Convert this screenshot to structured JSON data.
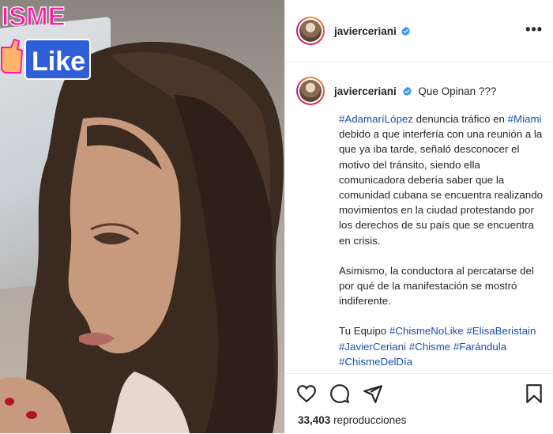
{
  "overlay": {
    "line1": "ISME",
    "line2": "Like"
  },
  "header": {
    "username": "javierceriani",
    "more_label": "•••"
  },
  "caption": {
    "username": "javierceriani",
    "headline": "Que Opinan ???",
    "para1_parts": [
      {
        "text": "#AdamaríLópez",
        "tag": true
      },
      {
        "text": " denuncia tráfico en ",
        "tag": false
      },
      {
        "text": "#Miami",
        "tag": true
      },
      {
        "text": " debido a que interfería con una reunión a la que ya iba tarde, señaló desconocer el motivo del tránsito, siendo ella comunicadora debería saber que la comunidad cubana se encuentra realizando movimientos en la ciudad protestando por los derechos de su país que se encuentra en crisis.",
        "tag": false
      }
    ],
    "para2": "Asimismo, la conductora al percatarse del por qué de la manifestación se mostró indiferente.",
    "para3_parts": [
      {
        "text": "Tu Equipo ",
        "tag": false
      },
      {
        "text": "#ChismeNoLike",
        "tag": true
      },
      {
        "text": " ",
        "tag": false
      },
      {
        "text": "#ElisaBeristain",
        "tag": true
      },
      {
        "text": " ",
        "tag": false
      },
      {
        "text": "#JavierCeriani",
        "tag": true
      },
      {
        "text": " ",
        "tag": false
      },
      {
        "text": "#Chisme",
        "tag": true
      },
      {
        "text": " ",
        "tag": false
      },
      {
        "text": "#Farándula",
        "tag": true
      },
      {
        "text": " ",
        "tag": false
      },
      {
        "text": "#ChismeDelDía",
        "tag": true
      }
    ]
  },
  "stats": {
    "views_count": "33,403",
    "views_label": "reproducciones"
  },
  "icons": [
    "heart-icon",
    "comment-icon",
    "share-icon",
    "bookmark-icon",
    "verified-icon",
    "more-icon"
  ],
  "colors": {
    "hashtag": "#1a4fa8",
    "verified": "#3897f0",
    "badge_pink": "#ff1aa3",
    "badge_blue": "#2f5fd6"
  }
}
